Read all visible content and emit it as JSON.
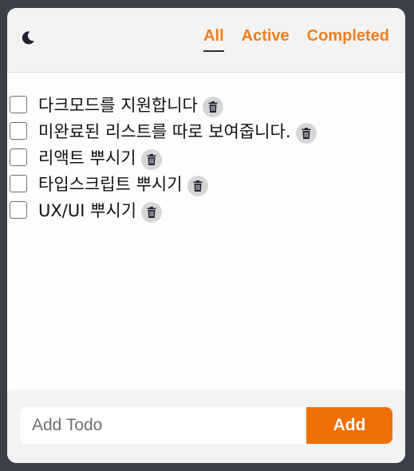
{
  "header": {
    "theme_toggle_icon": "moon-icon",
    "filters": [
      {
        "label": "All",
        "selected": true
      },
      {
        "label": "Active",
        "selected": false
      },
      {
        "label": "Completed",
        "selected": false
      }
    ]
  },
  "todos": [
    {
      "text": "다크모드를 지원합니다",
      "checked": false
    },
    {
      "text": "미완료된 리스트를 따로 보여줍니다.",
      "checked": false
    },
    {
      "text": "리액트 뿌시기",
      "checked": false
    },
    {
      "text": "타입스크립트 뿌시기",
      "checked": false
    },
    {
      "text": "UX/UI 뿌시기",
      "checked": false
    }
  ],
  "footer": {
    "input_placeholder": "Add Todo",
    "add_label": "Add"
  },
  "colors": {
    "accent": "#f17e1e",
    "button": "#f06f02",
    "icon_dark": "#1f2130",
    "trash_bg": "#d6d6d6"
  }
}
